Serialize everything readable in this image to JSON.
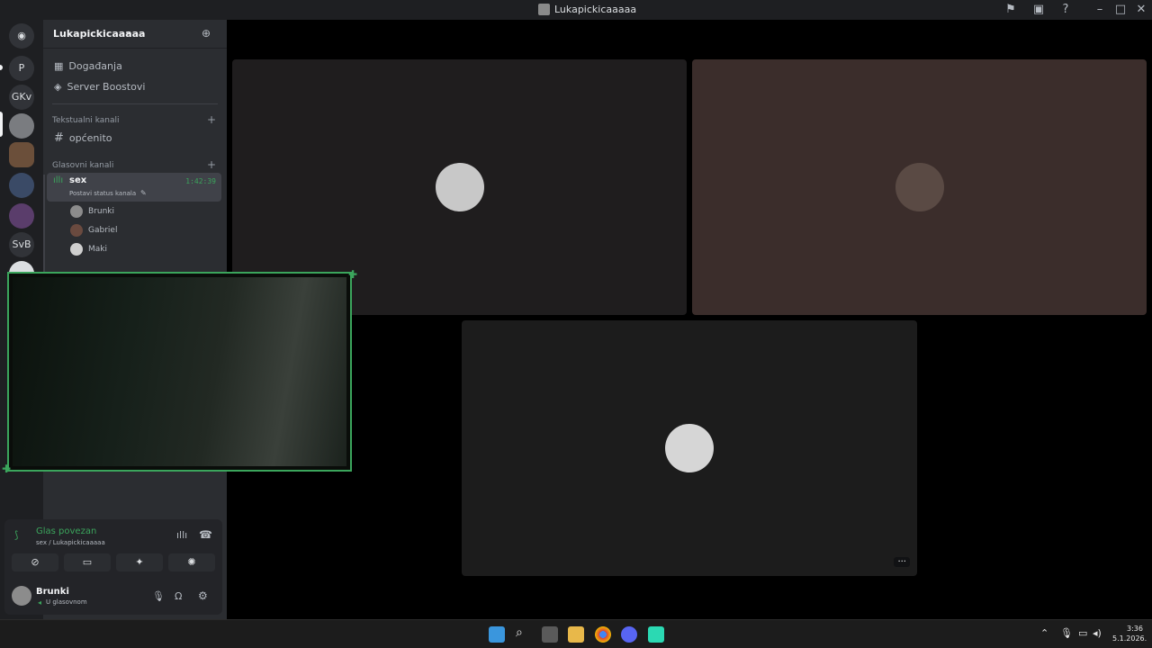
{
  "titlebar": {
    "title": "Lukapickicaaaaa"
  },
  "rail": {
    "servers": [
      {
        "label": "P"
      },
      {
        "label": "GKv"
      },
      {
        "label": "SvB"
      }
    ]
  },
  "guild": {
    "name": "Lukapickicaaaaa"
  },
  "sidebar": {
    "events": "Događanja",
    "boosts": "Server Boostovi",
    "text_category": "Tekstualni kanali",
    "text_channel": "općenito",
    "voice_category": "Glasovni kanali",
    "voice_channel": "sex",
    "voice_timer": "1:42:39",
    "voice_status": "Postavi status kanala",
    "voice_users": [
      "Brunki",
      "Gabriel",
      "Maki"
    ]
  },
  "voice_panel": {
    "status": "Glas povezan",
    "location": "sex / Lukapickicaaaaa"
  },
  "user_panel": {
    "name": "Brunki",
    "status": "U glasovnom"
  },
  "stage": {
    "more_label": "···"
  },
  "taskbar": {
    "time": "3:36",
    "date": "5.1.2026."
  },
  "colors": {
    "accent_green": "#3ba55c",
    "panel": "#2b2d31",
    "rail": "#1e1f22"
  }
}
